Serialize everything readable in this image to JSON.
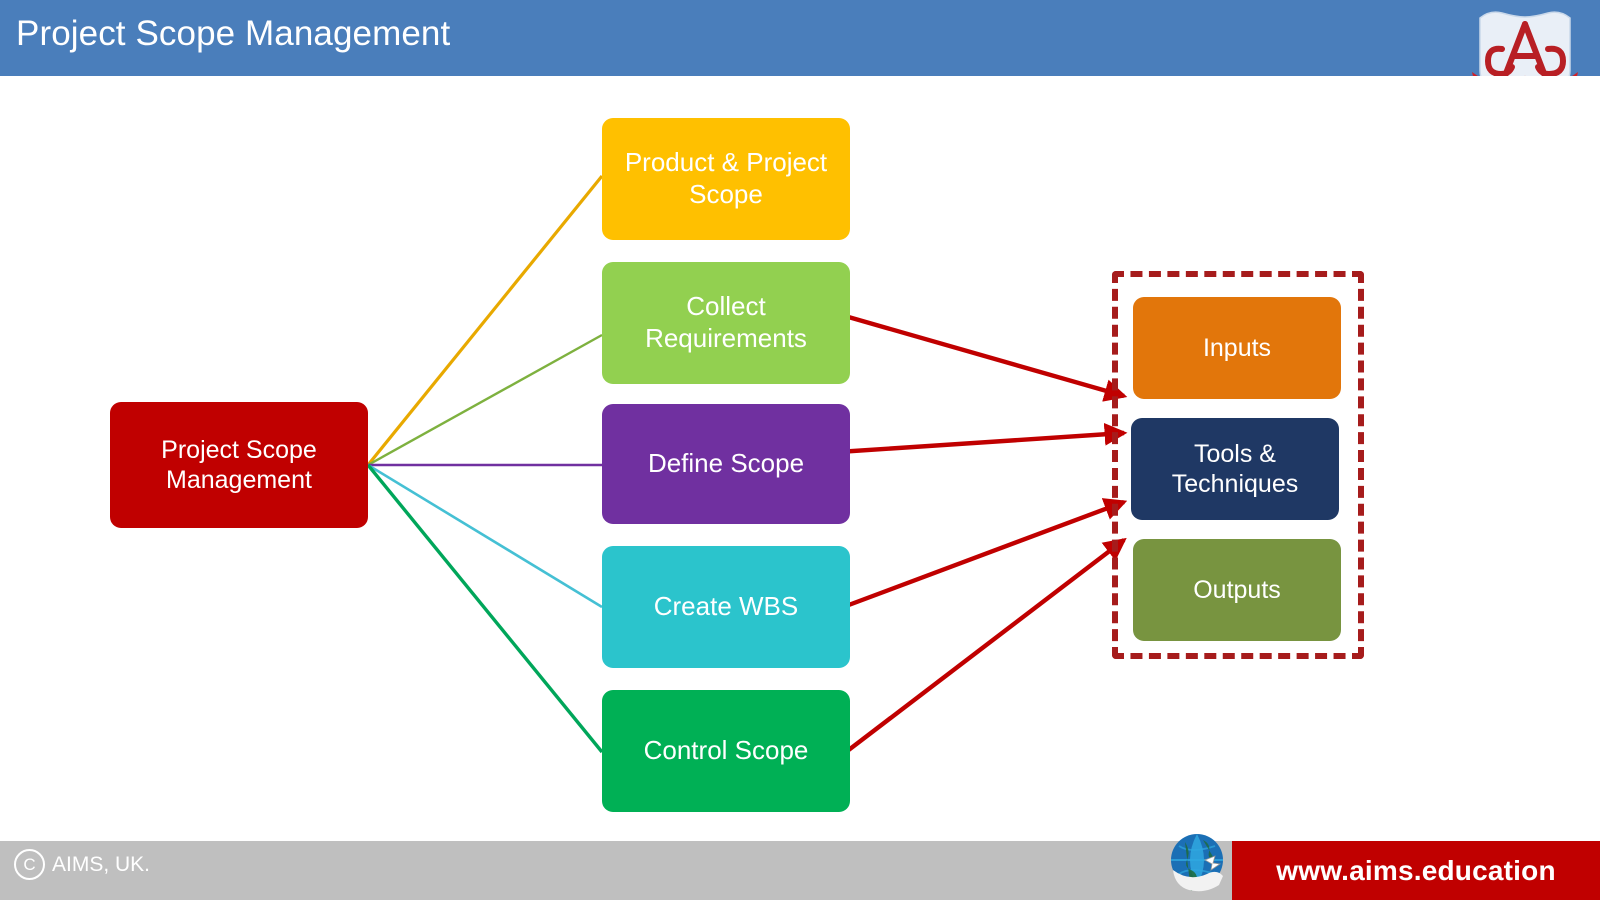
{
  "header": {
    "title": "Project Scope Management",
    "bg_color": "#4A7EBB",
    "logo_name": "aims-logo"
  },
  "footer": {
    "copyright_symbol": "C",
    "copyright_text": "AIMS, UK.",
    "url_text": "www.aims.education",
    "bar_color": "#BFBFBF",
    "url_band_color": "#C00000",
    "globe_name": "globe-icon"
  },
  "diagram": {
    "root": {
      "label": "Project Scope\nManagement",
      "line1": "Project Scope",
      "line2": "Management",
      "color": "#C00000"
    },
    "processes": [
      {
        "id": "product-project-scope",
        "label": "Product & Project Scope",
        "line1": "Product & Project",
        "line2": "Scope",
        "color": "#FFC000",
        "edge_color": "#E8A900"
      },
      {
        "id": "collect-requirements",
        "label": "Collect Requirements",
        "line1": "Collect",
        "line2": "Requirements",
        "color": "#92D050",
        "edge_color": "#7EB13F"
      },
      {
        "id": "define-scope",
        "label": "Define Scope",
        "line1": "Define Scope",
        "line2": "",
        "color": "#7030A0",
        "edge_color": "#7030A0"
      },
      {
        "id": "create-wbs",
        "label": "Create WBS",
        "line1": "Create WBS",
        "line2": "",
        "color": "#2BC4CC",
        "edge_color": "#45C0D4"
      },
      {
        "id": "control-scope",
        "label": "Control Scope",
        "line1": "Control Scope",
        "line2": "",
        "color": "#00B055",
        "edge_color": "#00A65A"
      }
    ],
    "itto": {
      "border_color": "#A61C1C",
      "items": [
        {
          "id": "inputs",
          "label": "Inputs",
          "line1": "Inputs",
          "line2": "",
          "color": "#E2760B"
        },
        {
          "id": "tools-techniques",
          "label": "Tools & Techniques",
          "line1": "Tools &",
          "line2": "Techniques",
          "color": "#1F3864"
        },
        {
          "id": "outputs",
          "label": "Outputs",
          "line1": "Outputs",
          "line2": "",
          "color": "#789440"
        }
      ]
    },
    "arrow_color": "#C00000"
  }
}
